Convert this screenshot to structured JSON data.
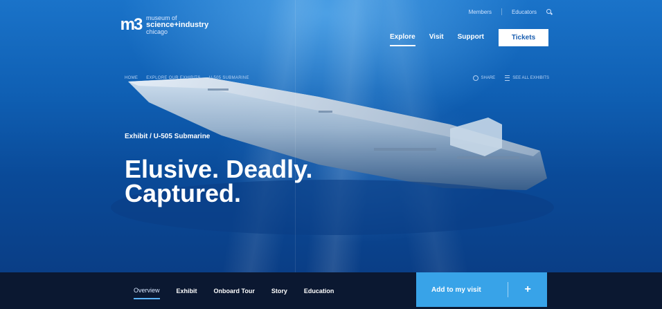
{
  "header": {
    "logo": {
      "mark": "m3",
      "line1": "museum of",
      "line2": "science+industry",
      "line3": "chicago"
    },
    "utility": {
      "item1": "Members",
      "item2": "Educators"
    },
    "nav": [
      {
        "label": "Explore"
      },
      {
        "label": "Visit"
      },
      {
        "label": "Support"
      }
    ],
    "tickets_label": "Tickets"
  },
  "breadcrumb": [
    "HOME",
    "EXPLORE OUR EXHIBITS",
    "U-505 SUBMARINE"
  ],
  "actions": {
    "share": "SHARE",
    "all_exhibits": "SEE ALL EXHIBITS"
  },
  "hero": {
    "kicker": "Exhibit / U-505 Submarine",
    "headline_line1": "Elusive. Deadly.",
    "headline_line2": "Captured."
  },
  "tabs": [
    {
      "label": "Overview"
    },
    {
      "label": "Exhibit"
    },
    {
      "label": "Onboard Tour"
    },
    {
      "label": "Story"
    },
    {
      "label": "Education"
    }
  ],
  "cta": {
    "label": "Add to my visit",
    "plus": "+"
  },
  "colors": {
    "accent": "#38a3e8",
    "bar": "#0b1831",
    "hero": "#0f5fb3"
  }
}
